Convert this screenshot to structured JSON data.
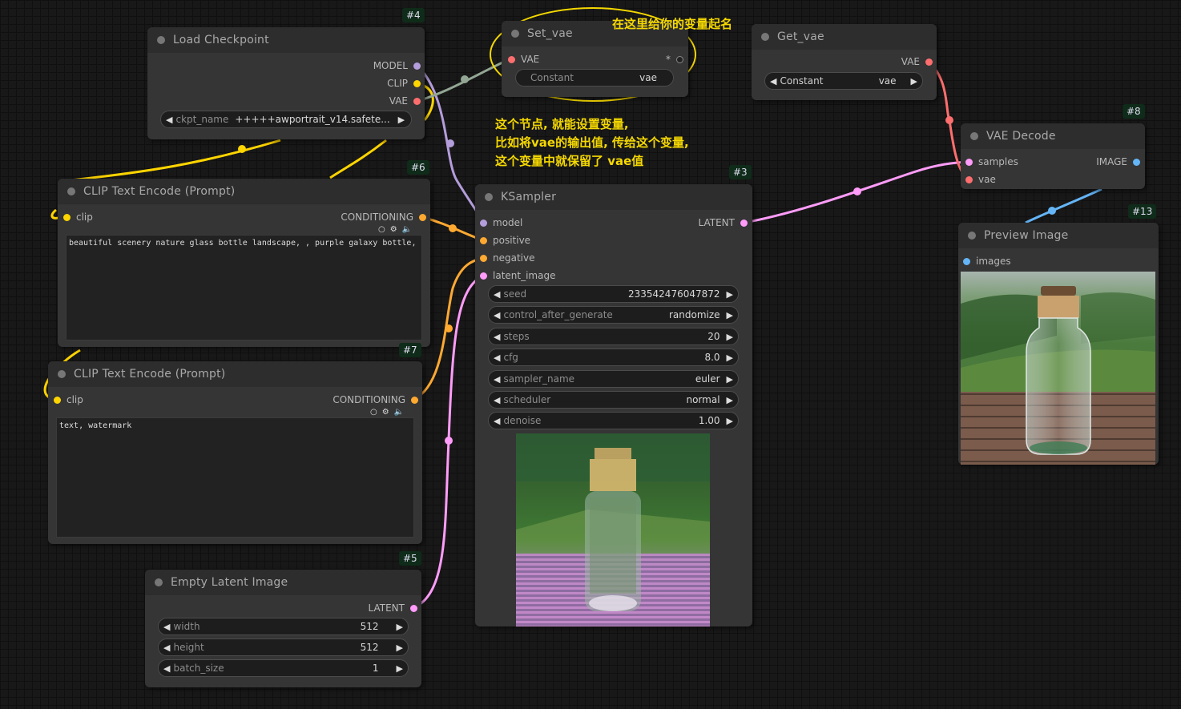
{
  "nodes": {
    "load_checkpoint": {
      "badge": "#4",
      "title": "Load Checkpoint",
      "outputs": [
        "MODEL",
        "CLIP",
        "VAE"
      ],
      "ckpt_label": "ckpt_name",
      "ckpt_value": "+++++awportrait_v14.safete..."
    },
    "set_vae": {
      "title": "Set_vae",
      "input": "VAE",
      "input_right": "*",
      "constant_label": "Constant",
      "constant_value": "vae"
    },
    "get_vae": {
      "title": "Get_vae",
      "output": "VAE",
      "constant_label": "Constant",
      "constant_value": "vae"
    },
    "clip_pos": {
      "badge": "#6",
      "title": "CLIP Text Encode (Prompt)",
      "input": "clip",
      "output": "CONDITIONING",
      "text": "beautiful scenery nature glass bottle landscape, , purple galaxy bottle,"
    },
    "clip_neg": {
      "badge": "#7",
      "title": "CLIP Text Encode (Prompt)",
      "input": "clip",
      "output": "CONDITIONING",
      "text": "text, watermark"
    },
    "ksampler": {
      "badge": "#3",
      "title": "KSampler",
      "inputs": [
        "model",
        "positive",
        "negative",
        "latent_image"
      ],
      "output": "LATENT",
      "widgets": [
        {
          "label": "seed",
          "value": "233542476047872"
        },
        {
          "label": "control_after_generate",
          "value": "randomize"
        },
        {
          "label": "steps",
          "value": "20"
        },
        {
          "label": "cfg",
          "value": "8.0"
        },
        {
          "label": "sampler_name",
          "value": "euler"
        },
        {
          "label": "scheduler",
          "value": "normal"
        },
        {
          "label": "denoise",
          "value": "1.00"
        }
      ]
    },
    "vae_decode": {
      "badge": "#8",
      "title": "VAE Decode",
      "inputs": [
        "samples",
        "vae"
      ],
      "output": "IMAGE"
    },
    "preview": {
      "badge": "#13",
      "title": "Preview Image",
      "input": "images"
    },
    "empty_latent": {
      "badge": "#5",
      "title": "Empty Latent Image",
      "output": "LATENT",
      "widgets": [
        {
          "label": "width",
          "value": "512"
        },
        {
          "label": "height",
          "value": "512"
        },
        {
          "label": "batch_size",
          "value": "1"
        }
      ]
    }
  },
  "annotations": {
    "top": "在这里给你的变量起名",
    "line1": "这个节点, 就能设置变量,",
    "line2": "比如将vae的输出值, 传给这个变量,",
    "line3": "这个变量中就保留了 vae值"
  },
  "colors": {
    "model": "#b39ddb",
    "clip": "#ffd500",
    "vae": "#ff6e6e",
    "conditioning": "#ffa931",
    "latent": "#ff9cf9",
    "image": "#64b5f6",
    "vae_setget": "#93a694",
    "annotation": "#f5d800",
    "badge_bg": "#0f2b19"
  }
}
